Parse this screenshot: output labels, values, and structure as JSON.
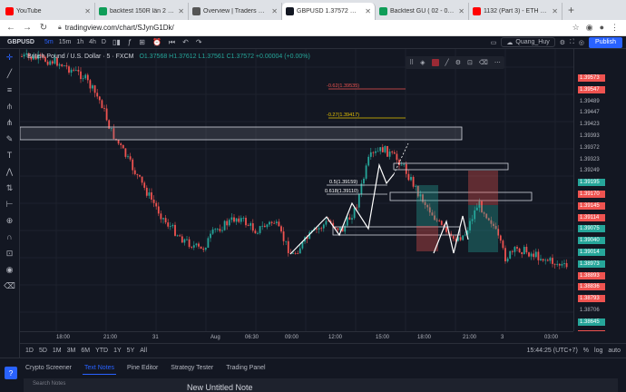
{
  "browser": {
    "tabs": [
      {
        "label": "YouTube",
        "color": "#ff0000"
      },
      {
        "label": "backtest 150R lần 2 - Goog",
        "color": "#0f9d58"
      },
      {
        "label": "Overview | Traders Central",
        "color": "#555555"
      },
      {
        "label": "GBPUSD 1.37572 ▲ +0.42",
        "color": "#131722",
        "active": true
      },
      {
        "label": "Backtest GU ( 02 - 08 - 20",
        "color": "#0f9d58"
      },
      {
        "label": "1132 (Part 3) - ETH B...",
        "color": "#ff0000"
      }
    ],
    "url": "tradingview.com/chart/SJynG1Dk/"
  },
  "topbar": {
    "symbol": "GBPUSD",
    "timeframes": [
      "5m",
      "15m",
      "1h",
      "4h",
      "D"
    ],
    "active_tf": "5m",
    "user": "Quang_Huy",
    "publish": "Publish"
  },
  "legend": {
    "title": "British Pound / U.S. Dollar · 5 · FXCM",
    "ohlc": "O1.37568 H1.37612 L1.37561 C1.37572 +0.00004 (+0.00%)"
  },
  "fib": {
    "l1": "-0.62(1.39535)",
    "l2": "-0.27(1.39417)",
    "l3": "0.5(1.39159)",
    "l4": "0.618(1.39110)"
  },
  "price_axis": [
    "1.39573",
    "1.39547",
    "1.39489",
    "1.39447",
    "1.39423",
    "1.39393",
    "1.39372",
    "1.39323",
    "1.39249",
    "1.39195",
    "1.39170",
    "1.39145",
    "1.39114",
    "1.39075",
    "1.39040",
    "1.39014",
    "1.38973",
    "1.38893",
    "1.38836",
    "1.38793",
    "1.38706",
    "1.38645",
    "1.38598"
  ],
  "time_axis": [
    "18:00",
    "21:00",
    "31",
    "Aug",
    "06:30",
    "09:00",
    "12:00",
    "15:00",
    "18:00",
    "21:00",
    "3",
    "03:00"
  ],
  "ranges": [
    "1D",
    "5D",
    "1M",
    "3M",
    "6M",
    "YTD",
    "1Y",
    "5Y",
    "All"
  ],
  "status": {
    "time": "15:44:25 (UTC+7)",
    "pct": "%",
    "log": "log",
    "auto": "auto"
  },
  "bottom_tabs": [
    "Crypto Screener",
    "Text Notes",
    "Pine Editor",
    "Strategy Tester",
    "Trading Panel"
  ],
  "active_bottom": "Text Notes",
  "panel_title": "New Untitled Note",
  "search_placeholder": "Search Notes",
  "colors": {
    "up": "#26a69a",
    "down": "#ef5350",
    "accent": "#2962ff"
  }
}
